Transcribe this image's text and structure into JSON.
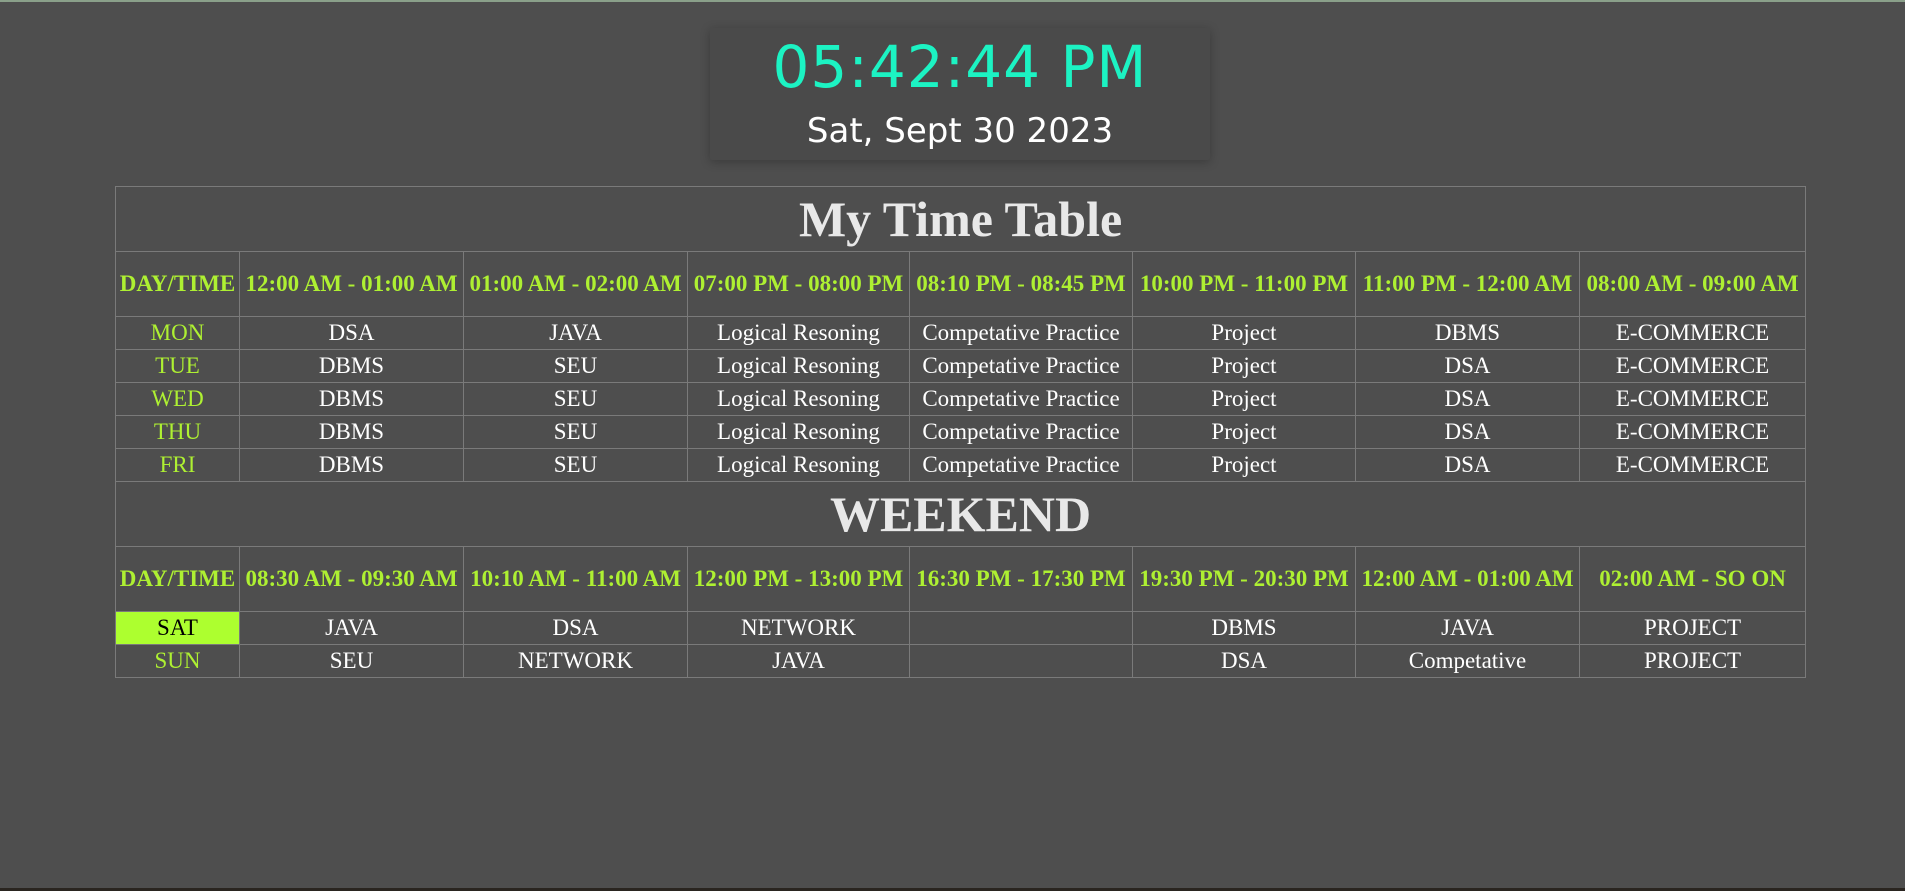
{
  "clock": {
    "time": "05:42:44 PM",
    "date": "Sat, Sept 30 2023"
  },
  "timetable": {
    "title": "My Time Table",
    "corner_label": "DAY/TIME",
    "weekday_slots": [
      "12:00 AM - 01:00 AM",
      "01:00 AM - 02:00 AM",
      "07:00 PM - 08:00 PM",
      "08:10 PM - 08:45 PM",
      "10:00 PM - 11:00 PM",
      "11:00 PM - 12:00 AM",
      "08:00 AM - 09:00 AM"
    ],
    "weekday_rows": [
      {
        "day": "MON",
        "cells": [
          "DSA",
          "JAVA",
          "Logical Resoning",
          "Competative Practice",
          "Project",
          "DBMS",
          "E-COMMERCE"
        ]
      },
      {
        "day": "TUE",
        "cells": [
          "DBMS",
          "SEU",
          "Logical Resoning",
          "Competative Practice",
          "Project",
          "DSA",
          "E-COMMERCE"
        ]
      },
      {
        "day": "WED",
        "cells": [
          "DBMS",
          "SEU",
          "Logical Resoning",
          "Competative Practice",
          "Project",
          "DSA",
          "E-COMMERCE"
        ]
      },
      {
        "day": "THU",
        "cells": [
          "DBMS",
          "SEU",
          "Logical Resoning",
          "Competative Practice",
          "Project",
          "DSA",
          "E-COMMERCE"
        ]
      },
      {
        "day": "FRI",
        "cells": [
          "DBMS",
          "SEU",
          "Logical Resoning",
          "Competative Practice",
          "Project",
          "DSA",
          "E-COMMERCE"
        ]
      }
    ],
    "weekend_title": "WEEKEND",
    "weekend_corner_label": "DAY/TIME",
    "weekend_slots": [
      "08:30 AM - 09:30 AM",
      "10:10 AM - 11:00 AM",
      "12:00 PM - 13:00 PM",
      "16:30 PM - 17:30 PM",
      "19:30 PM - 20:30 PM",
      "12:00 AM - 01:00 AM",
      "02:00 AM - SO ON"
    ],
    "weekend_rows": [
      {
        "day": "SAT",
        "highlighted": true,
        "cells": [
          "JAVA",
          "DSA",
          "NETWORK",
          "",
          "DBMS",
          "JAVA",
          "PROJECT"
        ]
      },
      {
        "day": "SUN",
        "highlighted": false,
        "cells": [
          "SEU",
          "NETWORK",
          "JAVA",
          "",
          "DSA",
          "Competative",
          "PROJECT"
        ]
      }
    ]
  },
  "colors": {
    "background": "#4e4e4e",
    "clock_time": "#1cf3c3",
    "header_green": "#aef032",
    "today_highlight": "#adff2f",
    "border": "#7a7a7a"
  }
}
